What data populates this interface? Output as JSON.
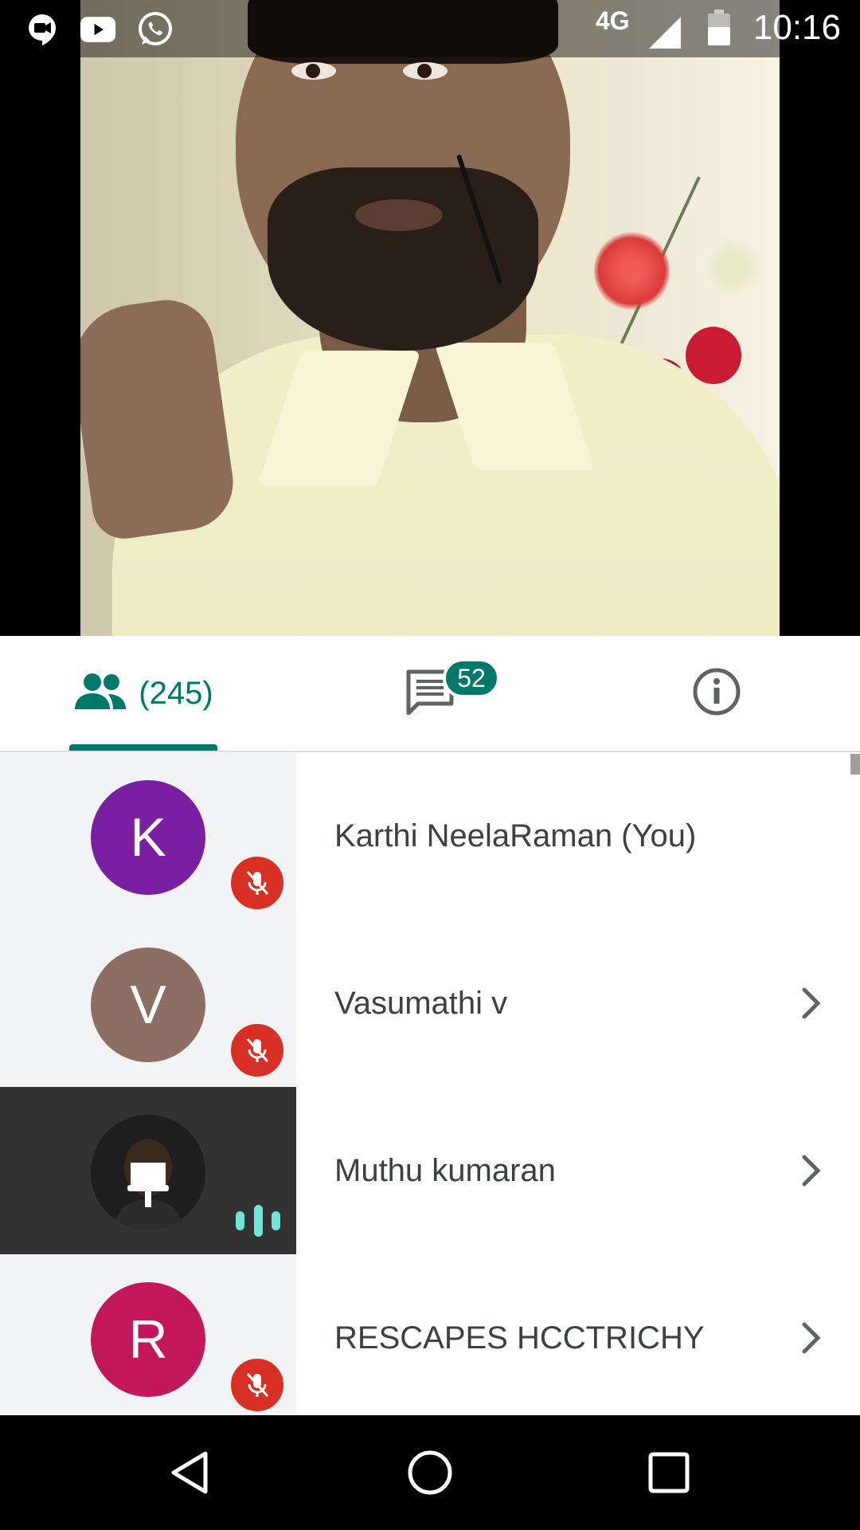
{
  "status_bar": {
    "network": "4G",
    "time": "10:16",
    "icons": [
      "hangouts-meet-icon",
      "youtube-icon",
      "whatsapp-icon",
      "signal-icon",
      "battery-icon"
    ]
  },
  "video": {
    "speaker_name": "Muthu kumaran"
  },
  "tabs": {
    "people_count": "(245)",
    "chat_badge": "52",
    "active": "people"
  },
  "participants": [
    {
      "initial": "K",
      "name": "Karthi NeelaRaman (You)",
      "avatar_color": "#7b1fa2",
      "muted": true,
      "chevron": false
    },
    {
      "initial": "V",
      "name": "Vasumathi v",
      "avatar_color": "#8d6e63",
      "muted": true,
      "chevron": true
    },
    {
      "initial": "",
      "name": "Muthu kumaran",
      "avatar_color": "#1b1b1b",
      "muted": false,
      "speaking": true,
      "chevron": true
    },
    {
      "initial": "R",
      "name": "RESCAPES HCCTRICHY",
      "avatar_color": "#c2185b",
      "muted": true,
      "chevron": true
    }
  ],
  "colors": {
    "accent": "#00796b",
    "mute_red": "#d93025",
    "speaking_teal": "#6ee7d8"
  }
}
